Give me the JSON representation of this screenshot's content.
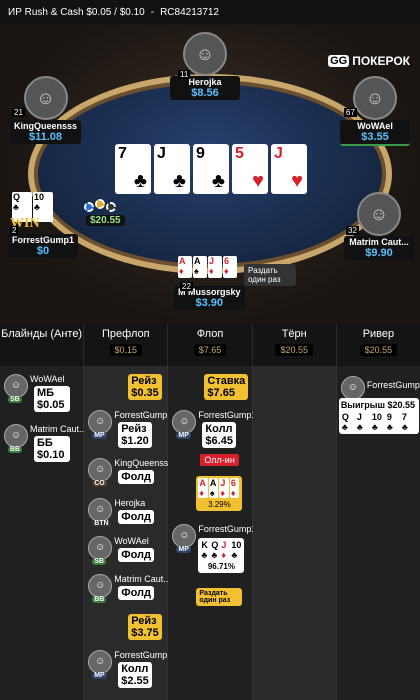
{
  "topbar": {
    "game": "ИР  Rush & Cash $0.05 / $0.10",
    "hand_id": "RC84213712"
  },
  "logo": {
    "gg": "GG",
    "text": "ПОКЕРОК"
  },
  "board": [
    {
      "rank": "7",
      "suit": "♣",
      "red": false
    },
    {
      "rank": "J",
      "suit": "♣",
      "red": false
    },
    {
      "rank": "9",
      "suit": "♣",
      "red": false
    },
    {
      "rank": "5",
      "suit": "♥",
      "red": true
    },
    {
      "rank": "J",
      "suit": "♥",
      "red": true
    }
  ],
  "players": {
    "herojka": {
      "name": "Herojka",
      "stack": "$8.56",
      "level": "11"
    },
    "kingqueen": {
      "name": "KingQueensss",
      "stack": "$11.08",
      "level": "21"
    },
    "wowael": {
      "name": "WoWAel",
      "stack": "$3.55",
      "level": "67"
    },
    "forrest": {
      "name": "ForrestGump1",
      "stack": "$0",
      "level": "2",
      "pot": "$20.55",
      "win": "WIN"
    },
    "matrim": {
      "name": "Matrim Caut...",
      "stack": "$9.90",
      "level": "32"
    },
    "hero": {
      "name": "M Mussorgsky",
      "stack": "$3.90",
      "level": "22"
    }
  },
  "forrest_cards": [
    {
      "rank": "Q",
      "suit": "♣",
      "red": false
    },
    {
      "rank": "10",
      "suit": "♣",
      "red": false
    }
  ],
  "hero_cards": [
    {
      "rank": "A",
      "suit": "♦",
      "red": true
    },
    {
      "rank": "A",
      "suit": "♠",
      "red": false
    },
    {
      "rank": "J",
      "suit": "♦",
      "red": true
    },
    {
      "rank": "6",
      "suit": "♦",
      "red": true
    }
  ],
  "run_once_label": "Раздать один раз",
  "streets": [
    {
      "label": "Блайнды (Анте)",
      "amount": ""
    },
    {
      "label": "Префлоп",
      "amount": "$0.15"
    },
    {
      "label": "Флоп",
      "amount": "$7.65"
    },
    {
      "label": "Тёрн",
      "amount": "$20.55"
    },
    {
      "label": "Ривер",
      "amount": "$20.55"
    }
  ],
  "blinds": [
    {
      "name": "WoWAel",
      "pos": "SB",
      "action": "МБ",
      "amount": "$0.05"
    },
    {
      "name": "Matrim Caut...",
      "pos": "BB",
      "action": "ББ",
      "amount": "$0.10"
    }
  ],
  "preflop": [
    {
      "name": "",
      "pos": "",
      "action": "Рейз",
      "amount": "$0.35"
    },
    {
      "name": "ForrestGump1",
      "pos": "MP",
      "action": "Рейз",
      "amount": "$1.20"
    },
    {
      "name": "KingQueensss",
      "pos": "CO",
      "action": "Фолд",
      "amount": ""
    },
    {
      "name": "Herojka",
      "pos": "BTN",
      "action": "Фолд",
      "amount": ""
    },
    {
      "name": "WoWAel",
      "pos": "SB",
      "action": "Фолд",
      "amount": ""
    },
    {
      "name": "Matrim Caut...",
      "pos": "BB",
      "action": "Фолд",
      "amount": ""
    },
    {
      "name": "",
      "pos": "",
      "action": "Рейз",
      "amount": "$3.75"
    },
    {
      "name": "ForrestGump1",
      "pos": "MP",
      "action": "Колл",
      "amount": "$2.55"
    }
  ],
  "flop": {
    "bet_action": "Ставка",
    "bet_amount": "$7.65",
    "call_name": "ForrestGump1",
    "call_pos": "MP",
    "call_action": "Колл",
    "call_amount": "$6.45",
    "allin": "Олл-ин",
    "hero_equity": "3.29%",
    "villain_name": "ForrestGump1",
    "villain_pos": "MP",
    "villain_equity": "96.71%",
    "run_once": "Раздать один раз"
  },
  "villain_cards": [
    {
      "rank": "K",
      "suit": "♣",
      "red": false
    },
    {
      "rank": "Q",
      "suit": "♣",
      "red": false
    },
    {
      "rank": "J",
      "suit": "♦",
      "red": true
    },
    {
      "rank": "10",
      "suit": "♣",
      "red": false
    }
  ],
  "river": {
    "name": "ForrestGump1",
    "result": "Выигрыш $20.55"
  },
  "river_cards": [
    {
      "rank": "Q",
      "suit": "♣",
      "red": false
    },
    {
      "rank": "J",
      "suit": "♣",
      "red": false
    },
    {
      "rank": "10",
      "suit": "♣",
      "red": false
    },
    {
      "rank": "9",
      "suit": "♣",
      "red": false
    },
    {
      "rank": "7",
      "suit": "♣",
      "red": false
    }
  ]
}
